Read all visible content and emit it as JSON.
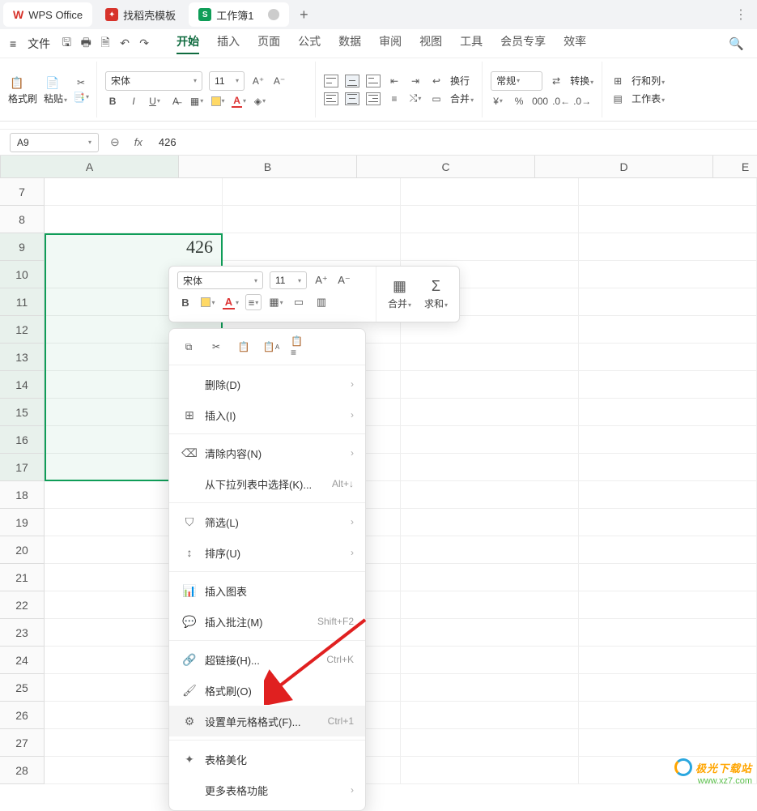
{
  "tabs": {
    "wps": "WPS Office",
    "template": "找稻壳模板",
    "doc": "工作簿1",
    "add": "+",
    "more": "⋮"
  },
  "menubar": {
    "file": "文件",
    "items": [
      "开始",
      "插入",
      "页面",
      "公式",
      "数据",
      "审阅",
      "视图",
      "工具",
      "会员专享",
      "效率"
    ],
    "active_index": 0
  },
  "ribbon": {
    "format_painter": "格式刷",
    "paste": "粘贴",
    "font_name": "宋体",
    "font_size": "11",
    "wrap": "换行",
    "merge": "合并",
    "general": "常规",
    "convert": "转换",
    "rowcol": "行和列",
    "sheet": "工作表"
  },
  "formula": {
    "cell": "A9",
    "fx": "fx",
    "value": "426"
  },
  "columns": [
    "A",
    "B",
    "C",
    "D",
    "E"
  ],
  "rows": [
    7,
    8,
    9,
    10,
    11,
    12,
    13,
    14,
    15,
    16,
    17,
    18,
    19,
    20,
    21,
    22,
    23,
    24,
    25,
    26,
    27,
    28
  ],
  "active_cell_value": "426",
  "mini": {
    "font": "宋体",
    "size": "11",
    "merge": "合并",
    "sum": "求和"
  },
  "ctx": {
    "delete": "删除(D)",
    "insert": "插入(I)",
    "clear": "清除内容(N)",
    "dropdown": "从下拉列表中选择(K)...",
    "dropdown_sc": "Alt+↓",
    "filter": "筛选(L)",
    "sort": "排序(U)",
    "chart": "插入图表",
    "comment": "插入批注(M)",
    "comment_sc": "Shift+F2",
    "hyperlink": "超链接(H)...",
    "hyperlink_sc": "Ctrl+K",
    "fpaint": "格式刷(O)",
    "cellfmt": "设置单元格格式(F)...",
    "cellfmt_sc": "Ctrl+1",
    "beautify": "表格美化",
    "more": "更多表格功能"
  },
  "watermark": {
    "brand": "极光下载站",
    "url": "www.xz7.com"
  }
}
